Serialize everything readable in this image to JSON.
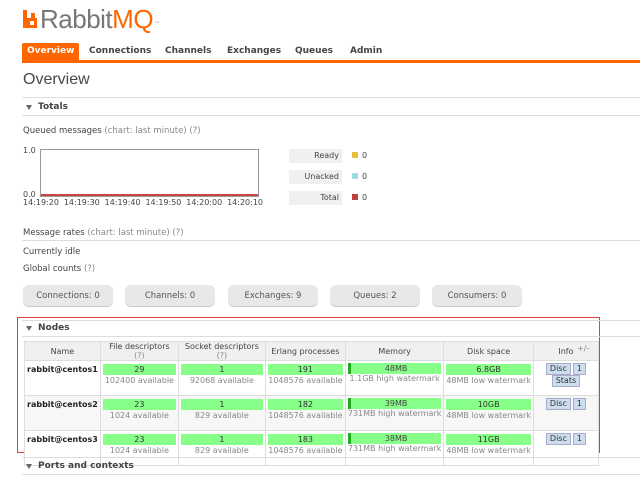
{
  "logo": {
    "part1": "Rabbit",
    "part2": "MQ",
    "tm": "™"
  },
  "tabs": [
    "Overview",
    "Connections",
    "Channels",
    "Exchanges",
    "Queues",
    "Admin"
  ],
  "page_title": "Overview",
  "totals": {
    "header": "Totals",
    "queued_label": "Queued messages",
    "queued_hint": "(chart: last minute)",
    "help": "(?)",
    "y_top": "1.0",
    "y_bottom": "0.0",
    "x_ticks": [
      "14:19:20",
      "14:19:30",
      "14:19:40",
      "14:19:50",
      "14:20:00",
      "14:20:10"
    ],
    "legend": [
      {
        "label": "Ready",
        "color": "#e8c040",
        "value": "0"
      },
      {
        "label": "Unacked",
        "color": "#a8d8ea",
        "value": "0"
      },
      {
        "label": "Total",
        "color": "#c04040",
        "value": "0"
      }
    ],
    "rates_label": "Message rates",
    "rates_hint": "(chart: last minute)",
    "idle": "Currently idle",
    "global_label": "Global counts",
    "counts": [
      {
        "label": "Connections: 0"
      },
      {
        "label": "Channels: 0"
      },
      {
        "label": "Exchanges: 9"
      },
      {
        "label": "Queues: 2"
      },
      {
        "label": "Consumers: 0"
      }
    ]
  },
  "nodes": {
    "header": "Nodes",
    "plusminus": "+/-",
    "columns": [
      "Name",
      "File descriptors",
      "(?)",
      "Socket descriptors",
      "(?)",
      "Erlang processes",
      "Memory",
      "Disk space",
      "Info"
    ],
    "rows": [
      {
        "name": "rabbit@centos1",
        "fd": "29",
        "fd_avail": "102400 available",
        "sd": "1",
        "sd_avail": "92068 available",
        "ep": "191",
        "ep_avail": "1048576 available",
        "mem": "48MB",
        "mem_sub": "1.1GB high watermark",
        "disk": "6.8GB",
        "disk_sub": "48MB low watermark",
        "info": [
          "Disc",
          "1",
          "Stats"
        ]
      },
      {
        "name": "rabbit@centos2",
        "fd": "23",
        "fd_avail": "1024 available",
        "sd": "1",
        "sd_avail": "829 available",
        "ep": "182",
        "ep_avail": "1048576 available",
        "mem": "39MB",
        "mem_sub": "731MB high watermark",
        "disk": "10GB",
        "disk_sub": "48MB low watermark",
        "info": [
          "Disc",
          "1"
        ]
      },
      {
        "name": "rabbit@centos3",
        "fd": "23",
        "fd_avail": "1024 available",
        "sd": "1",
        "sd_avail": "829 available",
        "ep": "183",
        "ep_avail": "1048576 available",
        "mem": "38MB",
        "mem_sub": "731MB high watermark",
        "disk": "11GB",
        "disk_sub": "48MB low watermark",
        "info": [
          "Disc",
          "1"
        ]
      }
    ]
  },
  "ports": {
    "header": "Ports and contexts"
  }
}
